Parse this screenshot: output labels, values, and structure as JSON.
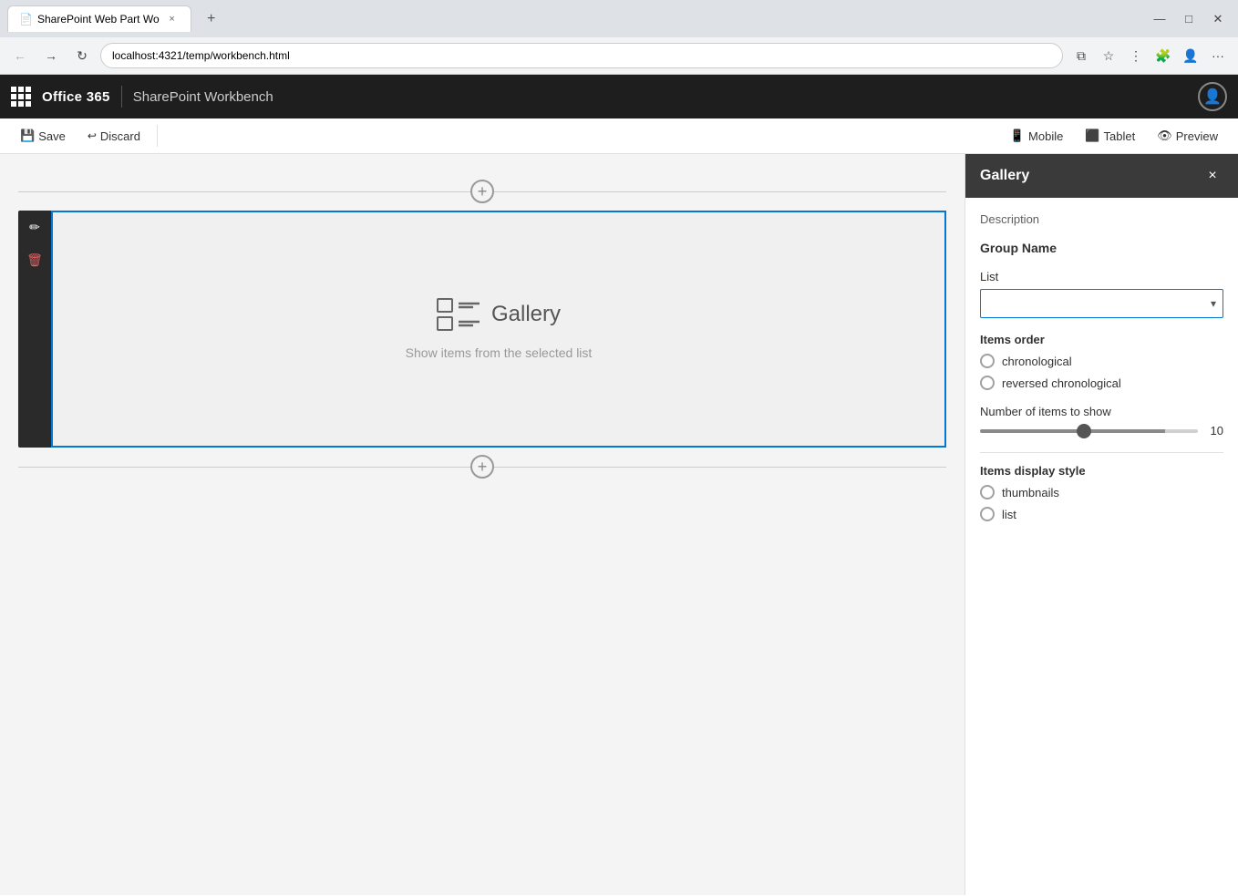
{
  "browser": {
    "tab_title": "SharePoint Web Part Wo",
    "url": "localhost:4321/temp/workbench.html",
    "new_tab_label": "+",
    "close_label": "×",
    "back_label": "←",
    "forward_label": "→",
    "reload_label": "↻",
    "favicon": "📄"
  },
  "app_header": {
    "app_name": "Office 365",
    "workbench_title": "SharePoint Workbench"
  },
  "toolbar": {
    "save_label": "Save",
    "discard_label": "Discard",
    "mobile_label": "Mobile",
    "tablet_label": "Tablet",
    "preview_label": "Preview"
  },
  "canvas": {
    "gallery_title": "Gallery",
    "gallery_subtitle": "Show items from the selected list",
    "add_icon": "+"
  },
  "side_panel": {
    "title": "Gallery",
    "close_label": "×",
    "description_label": "Description",
    "group_name_label": "Group Name",
    "list_label": "List",
    "list_placeholder": "",
    "items_order_label": "Items order",
    "order_options": [
      {
        "id": "chronological",
        "label": "chronological"
      },
      {
        "id": "reversed-chronological",
        "label": "reversed chronological"
      }
    ],
    "number_of_items_label": "Number of items to show",
    "number_of_items_value": 10,
    "items_display_label": "Items display style",
    "display_options": [
      {
        "id": "thumbnails",
        "label": "thumbnails"
      },
      {
        "id": "list",
        "label": "list"
      }
    ]
  },
  "webpart_tools": {
    "edit_icon": "✏",
    "delete_icon": "🗑"
  }
}
